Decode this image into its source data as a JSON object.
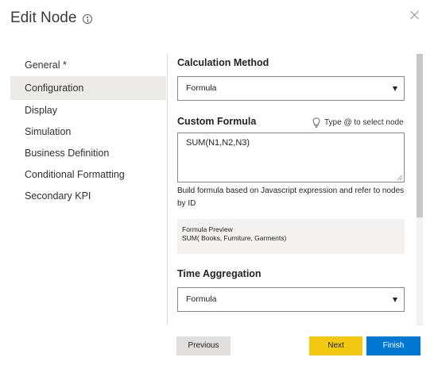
{
  "dialog": {
    "title": "Edit Node"
  },
  "nav": {
    "items": [
      {
        "label": "General *"
      },
      {
        "label": "Configuration"
      },
      {
        "label": "Display"
      },
      {
        "label": "Simulation"
      },
      {
        "label": "Business Definition"
      },
      {
        "label": "Conditional Formatting"
      },
      {
        "label": "Secondary KPI"
      }
    ],
    "selected": "Configuration"
  },
  "calculation_method": {
    "label": "Calculation Method",
    "value": "Formula"
  },
  "custom_formula": {
    "label": "Custom Formula",
    "hint": "Type @ to select node",
    "value": "SUM(N1,N2,N3)",
    "help": "Build formula based on Javascript expression and refer to nodes by ID"
  },
  "formula_preview": {
    "title": "Formula Preview",
    "value": "SUM( Books, Furniture, Garments)"
  },
  "time_aggregation": {
    "label": "Time Aggregation",
    "value": "Formula"
  },
  "footer": {
    "previous_label": "Previous",
    "next_label": "Next",
    "finish_label": "Finish"
  },
  "colors": {
    "accent": "#0078d4",
    "next_button": "#f2c811",
    "selected_nav": "#edebe9"
  }
}
